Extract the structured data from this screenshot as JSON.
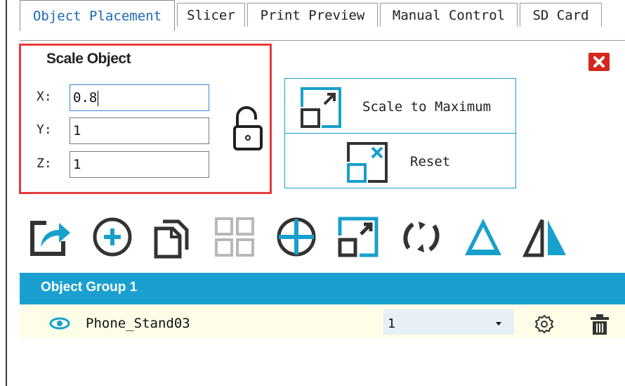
{
  "tabs": [
    {
      "label": "Object Placement",
      "active": true
    },
    {
      "label": "Slicer",
      "active": false
    },
    {
      "label": "Print Preview",
      "active": false
    },
    {
      "label": "Manual Control",
      "active": false
    },
    {
      "label": "SD Card",
      "active": false
    }
  ],
  "scale_panel": {
    "title": "Scale Object",
    "x_label": "X:",
    "y_label": "Y:",
    "z_label": "Z:",
    "x_value": "0.8",
    "y_value": "1",
    "z_value": "1",
    "lock_state": "unlocked",
    "close_icon": "close-icon"
  },
  "actions": {
    "scale_max_label": "Scale to Maximum",
    "reset_label": "Reset"
  },
  "toolbar": [
    "share-icon",
    "add-icon",
    "copy-icon",
    "grid-icon",
    "center-icon",
    "scale-icon",
    "rotate-icon",
    "lay-flat-icon",
    "mirror-icon"
  ],
  "object_group": {
    "title": "Object Group 1",
    "objects": [
      {
        "name": "Phone_Stand03",
        "copies": "1",
        "visible": true
      }
    ]
  },
  "colors": {
    "accent": "#19a0d0",
    "highlight_border": "#e43b3b",
    "close_bg": "#d7261d",
    "active_tab_text": "#1b67b8",
    "object_row_bg": "#fdfde8"
  }
}
